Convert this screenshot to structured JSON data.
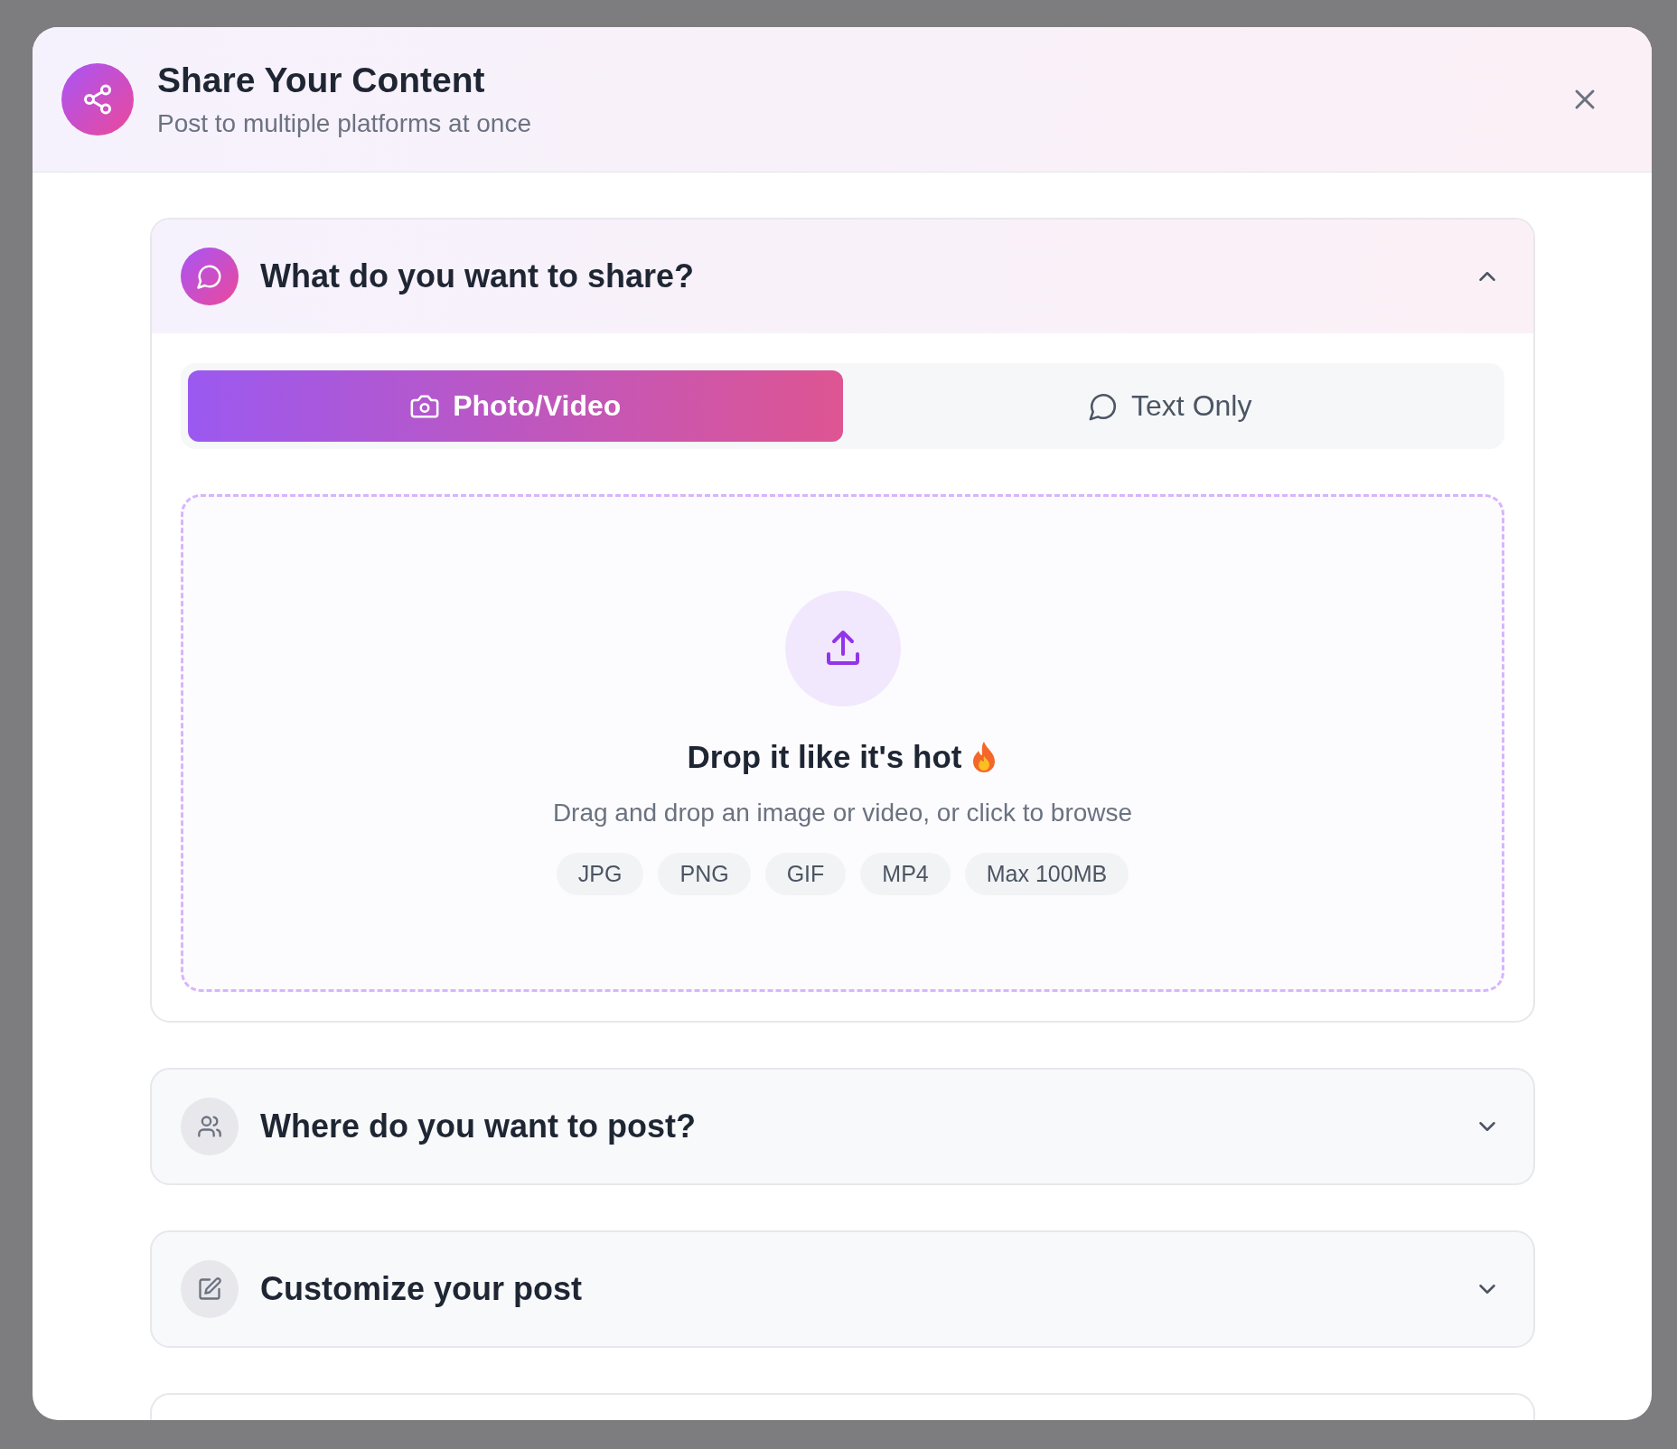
{
  "dialog": {
    "title": "Share Your Content",
    "subtitle": "Post to multiple platforms at once"
  },
  "sections": [
    {
      "kind": "chat",
      "title": "What do you want to share?",
      "expanded": true,
      "tabs": [
        {
          "kind": "camera",
          "label": "Photo/Video",
          "selected": true
        },
        {
          "kind": "chat",
          "label": "Text Only",
          "selected": false
        }
      ],
      "dropzone": {
        "heading": "Drop it like it's hot",
        "hint": "Drag and drop an image or video, or click to browse",
        "formats": [
          "JPG",
          "PNG",
          "GIF",
          "MP4",
          "Max 100MB"
        ]
      }
    },
    {
      "kind": "users",
      "title": "Where do you want to post?",
      "expanded": false
    },
    {
      "kind": "edit",
      "title": "Customize your post",
      "expanded": false
    },
    {
      "kind": "cut"
    }
  ]
}
